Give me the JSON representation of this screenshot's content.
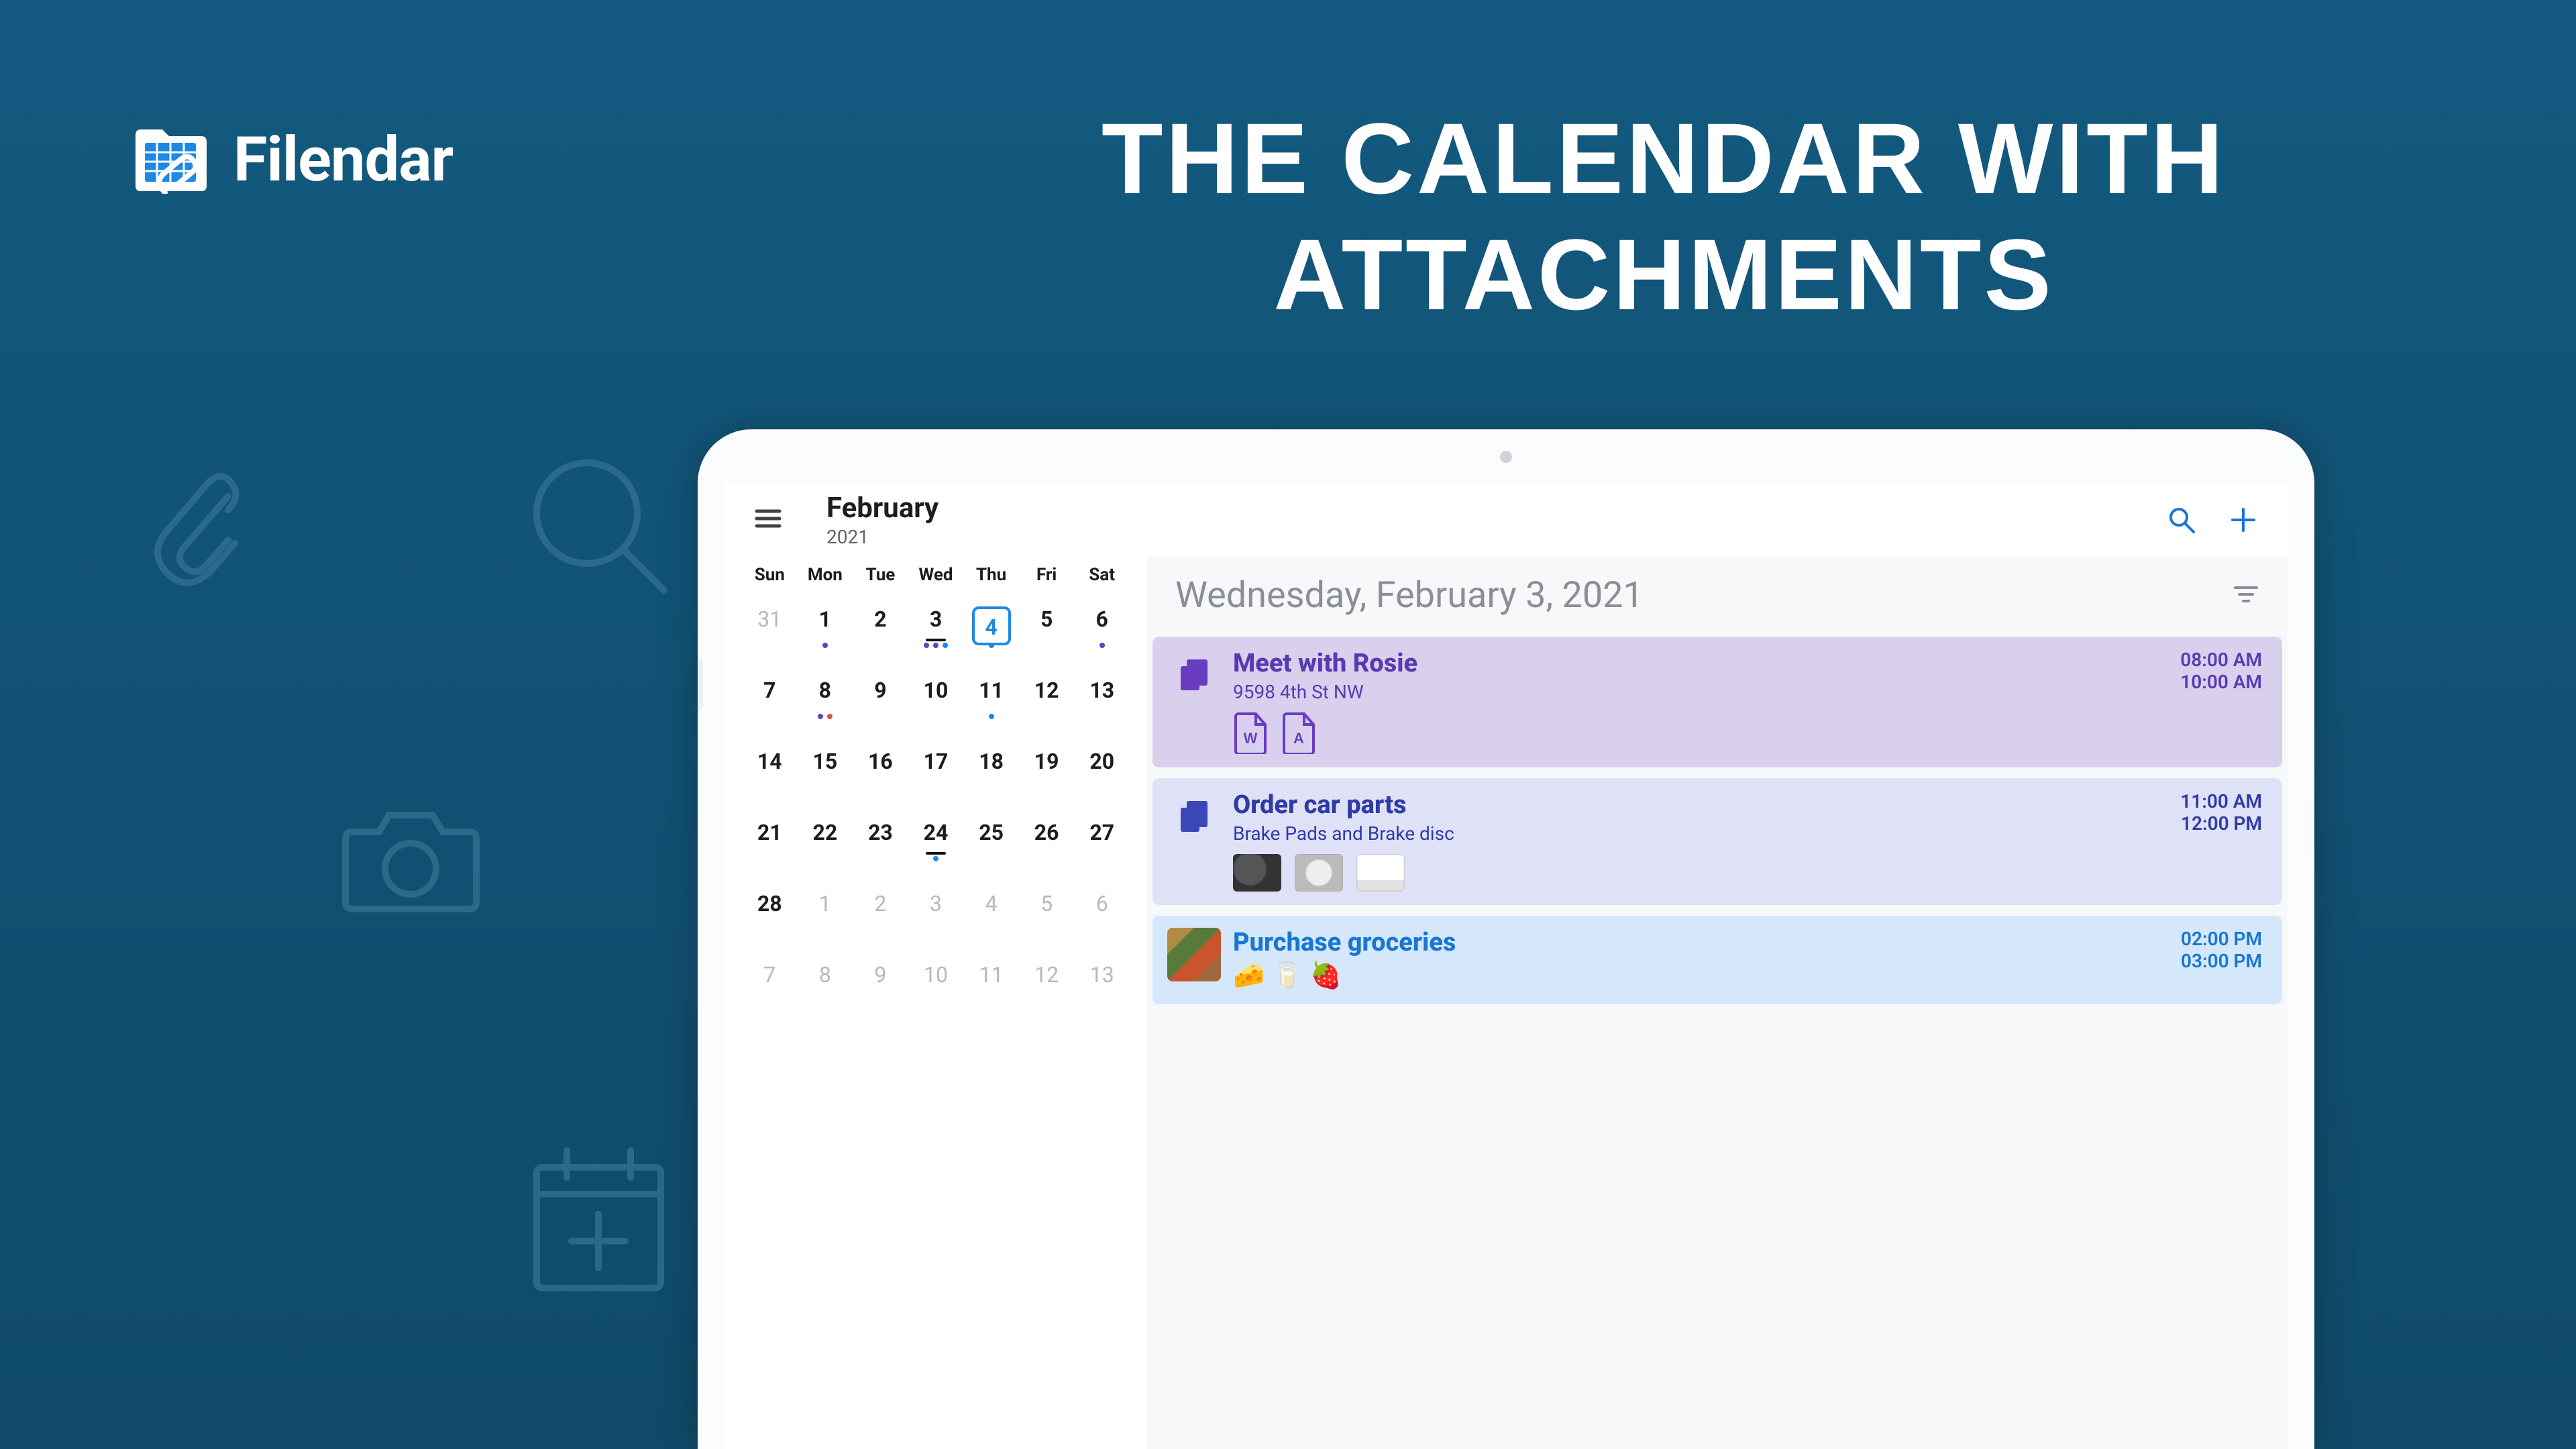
{
  "brand": {
    "name": "Filendar"
  },
  "tagline": "THE CALENDAR  WITH ATTACHMENTS",
  "appbar": {
    "month": "February",
    "year": "2021"
  },
  "calendar": {
    "day_headers": [
      "Sun",
      "Mon",
      "Tue",
      "Wed",
      "Thu",
      "Fri",
      "Sat"
    ],
    "weeks": [
      [
        {
          "n": "31",
          "other": true
        },
        {
          "n": "1",
          "dots": [
            "purple"
          ]
        },
        {
          "n": "2"
        },
        {
          "n": "3",
          "today": true,
          "dots": [
            "purple",
            "purple",
            "blue"
          ]
        },
        {
          "n": "4",
          "selected": true,
          "dots": [
            "blue"
          ]
        },
        {
          "n": "5"
        },
        {
          "n": "6",
          "dots": [
            "purple"
          ]
        }
      ],
      [
        {
          "n": "7"
        },
        {
          "n": "8",
          "dots": [
            "purple",
            "red"
          ]
        },
        {
          "n": "9"
        },
        {
          "n": "10"
        },
        {
          "n": "11",
          "dots": [
            "blue"
          ]
        },
        {
          "n": "12"
        },
        {
          "n": "13"
        }
      ],
      [
        {
          "n": "14"
        },
        {
          "n": "15"
        },
        {
          "n": "16"
        },
        {
          "n": "17"
        },
        {
          "n": "18"
        },
        {
          "n": "19"
        },
        {
          "n": "20"
        }
      ],
      [
        {
          "n": "21"
        },
        {
          "n": "22"
        },
        {
          "n": "23"
        },
        {
          "n": "24",
          "today": true,
          "dots": [
            "blue"
          ]
        },
        {
          "n": "25"
        },
        {
          "n": "26"
        },
        {
          "n": "27"
        }
      ],
      [
        {
          "n": "28"
        },
        {
          "n": "1",
          "other": true
        },
        {
          "n": "2",
          "other": true
        },
        {
          "n": "3",
          "other": true
        },
        {
          "n": "4",
          "other": true
        },
        {
          "n": "5",
          "other": true
        },
        {
          "n": "6",
          "other": true
        }
      ],
      [
        {
          "n": "7",
          "other": true
        },
        {
          "n": "8",
          "other": true
        },
        {
          "n": "9",
          "other": true
        },
        {
          "n": "10",
          "other": true
        },
        {
          "n": "11",
          "other": true
        },
        {
          "n": "12",
          "other": true
        },
        {
          "n": "13",
          "other": true
        }
      ]
    ]
  },
  "detail": {
    "date_label": "Wednesday, February 3, 2021",
    "events": [
      {
        "color": "purple",
        "leading": "copy-icon",
        "title": "Meet with Rosie",
        "subtitle": "9598 4th St NW",
        "attachments": [
          "word",
          "pdf"
        ],
        "start": "08:00 AM",
        "end": "10:00 AM"
      },
      {
        "color": "indigo",
        "leading": "copy-icon",
        "title": "Order car parts",
        "subtitle": "Brake Pads and Brake disc",
        "thumbs": 3,
        "start": "11:00 AM",
        "end": "12:00 PM"
      },
      {
        "color": "sky",
        "leading": "photo",
        "title": "Purchase groceries",
        "emoji": "🧀🥛🍓",
        "start": "02:00 PM",
        "end": "03:00 PM"
      }
    ]
  }
}
